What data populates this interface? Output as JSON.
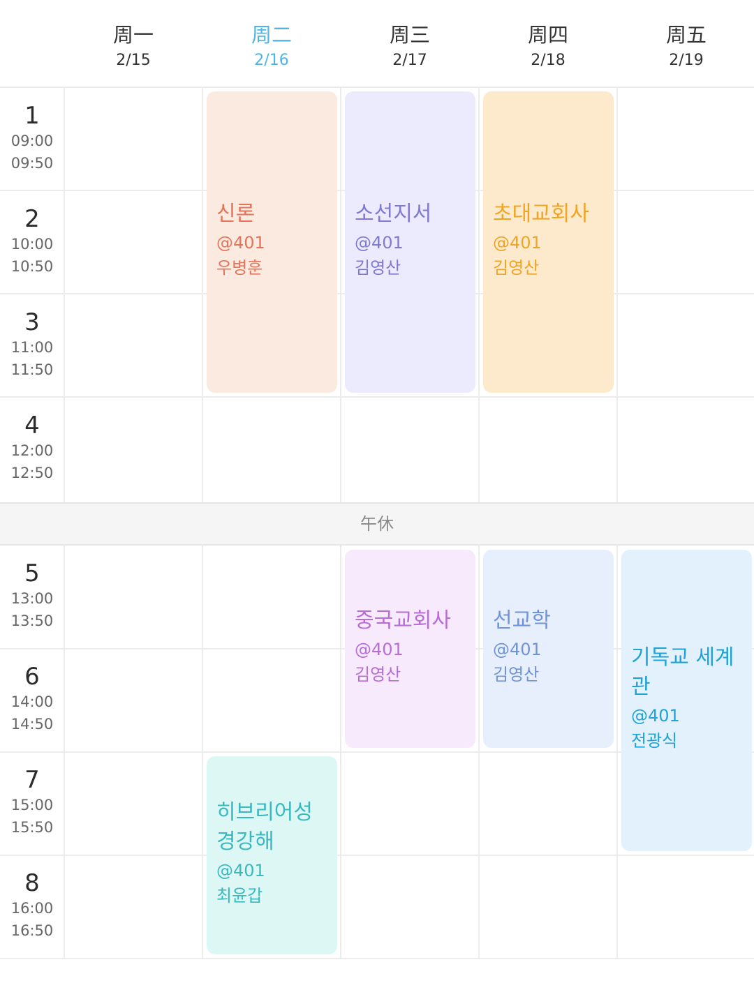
{
  "days": [
    {
      "dow": "周一",
      "date": "2/15"
    },
    {
      "dow": "周二",
      "date": "2/16"
    },
    {
      "dow": "周三",
      "date": "2/17"
    },
    {
      "dow": "周四",
      "date": "2/18"
    },
    {
      "dow": "周五",
      "date": "2/19"
    }
  ],
  "periods": [
    {
      "num": "1",
      "start": "09:00",
      "end": "09:50"
    },
    {
      "num": "2",
      "start": "10:00",
      "end": "10:50"
    },
    {
      "num": "3",
      "start": "11:00",
      "end": "11:50"
    },
    {
      "num": "4",
      "start": "12:00",
      "end": "12:50"
    },
    {
      "num": "5",
      "start": "13:00",
      "end": "13:50"
    },
    {
      "num": "6",
      "start": "14:00",
      "end": "14:50"
    },
    {
      "num": "7",
      "start": "15:00",
      "end": "15:50"
    },
    {
      "num": "8",
      "start": "16:00",
      "end": "16:50"
    }
  ],
  "lunch_label": "午休",
  "courses": [
    {
      "title": "신론",
      "room": "@401",
      "teacher": "우병훈",
      "bg": "#fbeadf",
      "fg": "#e8735a"
    },
    {
      "title": "소선지서",
      "room": "@401",
      "teacher": "김영산",
      "bg": "#ecebfd",
      "fg": "#7f79d2"
    },
    {
      "title": "초대교회사",
      "room": "@401",
      "teacher": "김영산",
      "bg": "#fdeacc",
      "fg": "#f0a424"
    },
    {
      "title": "중국교회사",
      "room": "@401",
      "teacher": "김영산",
      "bg": "#f6eafc",
      "fg": "#b86dd6"
    },
    {
      "title": "선교학",
      "room": "@401",
      "teacher": "김영산",
      "bg": "#e7effc",
      "fg": "#6f93d8"
    },
    {
      "title": "기독교 세계관",
      "room": "@401",
      "teacher": "전광식",
      "bg": "#e3f1fc",
      "fg": "#1fa3d6"
    },
    {
      "title": "히브리어성경강해",
      "room": "@401",
      "teacher": "최윤갑",
      "bg": "#ddf8f4",
      "fg": "#3ab8c0"
    }
  ]
}
